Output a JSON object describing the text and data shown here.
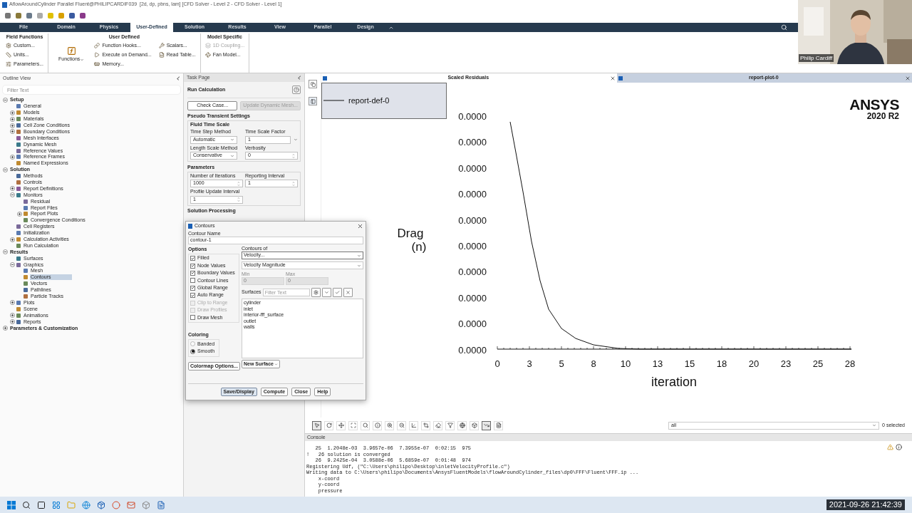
{
  "window": {
    "title": "AflowAroundCylinder Parallel Fluent@PHILIPCARDIF039  [2d, dp, pbns, lam] [CFD Solver - Level 2 - CFD Solver - Level 1]"
  },
  "ribbon": {
    "tabs": [
      {
        "label": "File",
        "selected": false
      },
      {
        "label": "Domain",
        "selected": false
      },
      {
        "label": "Physics",
        "selected": false
      },
      {
        "label": "User-Defined",
        "selected": true
      },
      {
        "label": "Solution",
        "selected": false
      },
      {
        "label": "Results",
        "selected": false
      },
      {
        "label": "View",
        "selected": false
      },
      {
        "label": "Parallel",
        "selected": false
      },
      {
        "label": "Design",
        "selected": false
      }
    ],
    "groups": [
      {
        "title": "Field Functions",
        "items": [
          {
            "kind": "small",
            "label": "Custom...",
            "disabled": false
          },
          {
            "kind": "small",
            "label": "Units...",
            "disabled": false
          },
          {
            "kind": "small",
            "label": "Parameters...",
            "disabled": false
          }
        ]
      },
      {
        "title": "User Defined",
        "items": [
          {
            "kind": "large",
            "label": "Functions",
            "disabled": false
          },
          {
            "kind": "small",
            "label": "Function Hooks...",
            "disabled": false
          },
          {
            "kind": "small",
            "label": "Execute on Demand...",
            "disabled": false
          },
          {
            "kind": "small",
            "label": "Memory...",
            "disabled": false
          },
          {
            "kind": "small",
            "label": "Scalars...",
            "disabled": false
          },
          {
            "kind": "small",
            "label": "Read Table...",
            "disabled": false
          }
        ]
      },
      {
        "title": "Model Specific",
        "items": [
          {
            "kind": "small",
            "label": "1D Coupling...",
            "disabled": true
          },
          {
            "kind": "small",
            "label": "Fan Model...",
            "disabled": false
          }
        ]
      }
    ]
  },
  "outline": {
    "title": "Outline View",
    "filter": {
      "placeholder": "Filter Text"
    },
    "tree": [
      {
        "label": "Setup",
        "expanded": true,
        "selected": false,
        "children": [
          {
            "label": "General",
            "selected": false
          },
          {
            "label": "Models",
            "expanded": false,
            "selected": false
          },
          {
            "label": "Materials",
            "expanded": false,
            "selected": false
          },
          {
            "label": "Cell Zone Conditions",
            "expanded": false,
            "selected": false
          },
          {
            "label": "Boundary Conditions",
            "expanded": false,
            "selected": false
          },
          {
            "label": "Mesh Interfaces",
            "selected": false
          },
          {
            "label": "Dynamic Mesh",
            "selected": false
          },
          {
            "label": "Reference Values",
            "selected": false
          },
          {
            "label": "Reference Frames",
            "expanded": false,
            "selected": false
          },
          {
            "label": "Named Expressions",
            "selected": false
          }
        ]
      },
      {
        "label": "Solution",
        "expanded": true,
        "selected": false,
        "children": [
          {
            "label": "Methods",
            "selected": false
          },
          {
            "label": "Controls",
            "selected": false
          },
          {
            "label": "Report Definitions",
            "expanded": false,
            "selected": false
          },
          {
            "label": "Monitors",
            "expanded": true,
            "selected": false,
            "children": [
              {
                "label": "Residual",
                "selected": false
              },
              {
                "label": "Report Files",
                "selected": false
              },
              {
                "label": "Report Plots",
                "expanded": false,
                "selected": false
              },
              {
                "label": "Convergence Conditions",
                "selected": false
              }
            ]
          },
          {
            "label": "Cell Registers",
            "selected": false
          },
          {
            "label": "Initialization",
            "selected": false
          },
          {
            "label": "Calculation Activities",
            "expanded": false,
            "selected": false
          },
          {
            "label": "Run Calculation",
            "selected": false
          }
        ]
      },
      {
        "label": "Results",
        "expanded": true,
        "selected": false,
        "children": [
          {
            "label": "Surfaces",
            "selected": false
          },
          {
            "label": "Graphics",
            "expanded": true,
            "selected": false,
            "children": [
              {
                "label": "Mesh",
                "selected": false
              },
              {
                "label": "Contours",
                "selected": true
              },
              {
                "label": "Vectors",
                "selected": false
              },
              {
                "label": "Pathlines",
                "selected": false
              },
              {
                "label": "Particle Tracks",
                "selected": false
              }
            ]
          },
          {
            "label": "Plots",
            "expanded": false,
            "selected": false
          },
          {
            "label": "Scene",
            "selected": false
          },
          {
            "label": "Animations",
            "expanded": false,
            "selected": false
          },
          {
            "label": "Reports",
            "expanded": false,
            "selected": false
          }
        ]
      },
      {
        "label": "Parameters & Customization",
        "expanded": false,
        "selected": false
      }
    ]
  },
  "task_page": {
    "title": "Task Page",
    "heading": "Run Calculation",
    "buttons": [
      {
        "label": "Check Case...",
        "disabled": false
      },
      {
        "label": "Update Dynamic Mesh...",
        "disabled": true
      }
    ],
    "section": "Pseudo Transient Settings",
    "group": "Fluid Time Scale",
    "fields": [
      {
        "label": "Time Step Method",
        "value": "Automatic",
        "kind": "dropdown"
      },
      {
        "label": "Time Scale Factor",
        "value": "1",
        "kind": "combo"
      },
      {
        "label": "Length Scale Method",
        "value": "Conservative",
        "kind": "dropdown"
      },
      {
        "label": "Verbosity",
        "value": "0",
        "kind": "spinner"
      }
    ],
    "parameters": {
      "title": "Parameters",
      "fields": [
        {
          "label": "Number of Iterations",
          "value": "1000",
          "kind": "spinner"
        },
        {
          "label": "Reporting Interval",
          "value": "1",
          "kind": "spinner"
        },
        {
          "label": "Profile Update Interval",
          "value": "1",
          "kind": "spinner"
        }
      ]
    },
    "next_section": "Solution Processing"
  },
  "contours_dialog": {
    "title": "Contours",
    "name_label": "Contour Name",
    "name_value": "contour-1",
    "options_title": "Options",
    "options": [
      {
        "label": "Filled",
        "checked": true,
        "disabled": false
      },
      {
        "label": "Node Values",
        "checked": true,
        "disabled": false
      },
      {
        "label": "Boundary Values",
        "checked": true,
        "disabled": false
      },
      {
        "label": "Contour Lines",
        "checked": false,
        "disabled": false
      },
      {
        "label": "Global Range",
        "checked": true,
        "disabled": false
      },
      {
        "label": "Auto Range",
        "checked": true,
        "disabled": false
      },
      {
        "label": "Clip to Range",
        "checked": false,
        "disabled": true
      },
      {
        "label": "Draw Profiles",
        "checked": false,
        "disabled": true
      },
      {
        "label": "Draw Mesh",
        "checked": false,
        "disabled": false
      }
    ],
    "contours_of_label": "Contours of",
    "contours_of": [
      "Velocity...",
      "Velocity Magnitude"
    ],
    "min": {
      "label": "Min",
      "value": "0",
      "disabled": true
    },
    "max": {
      "label": "Max",
      "value": "0",
      "disabled": true
    },
    "surfaces_label": "Surfaces",
    "surfaces_filter": {
      "placeholder": "Filter Text"
    },
    "surfaces": [
      {
        "label": "cylinder",
        "selected": false
      },
      {
        "label": "inlet",
        "selected": false
      },
      {
        "label": "interior-fff_surface",
        "selected": false
      },
      {
        "label": "outlet",
        "selected": false
      },
      {
        "label": "walls",
        "selected": false
      }
    ],
    "coloring_title": "Coloring",
    "coloring": [
      {
        "label": "Banded",
        "selected": false
      },
      {
        "label": "Smooth",
        "selected": true
      }
    ],
    "colormap_button": "Colormap Options...",
    "new_surface_button": "New Surface",
    "buttons": [
      "Save/Display",
      "Compute",
      "Close",
      "Help"
    ]
  },
  "graphics": {
    "tabs": [
      {
        "label": "Scaled Residuals",
        "selected": false
      },
      {
        "label": "report-plot-0",
        "selected": true
      }
    ],
    "plot": {
      "legend": "report-def-0",
      "ylabel": [
        "Drag",
        "(n)"
      ],
      "yticks": [
        "0.0000",
        "0.0000",
        "0.0000",
        "0.0000",
        "0.0000",
        "0.0000",
        "0.0000",
        "0.0000",
        "0.0000",
        "0.0000"
      ],
      "xticks": [
        "0",
        "3",
        "5",
        "8",
        "10",
        "13",
        "15",
        "18",
        "20",
        "23",
        "25",
        "28"
      ],
      "xlabel": "iteration"
    },
    "logo": {
      "name": "ANSYS",
      "version": "2020 R2"
    }
  },
  "graphics_toolbar": {
    "filter": "all",
    "selection": "0 selected"
  },
  "console": {
    "title": "Console",
    "lines": [
      "   25  1.2048e-03  3.9657e-06  7.3955e-07  0:02:15  975",
      "!   26 solution is converged",
      "   26  9.2425e-04  3.0588e-06  5.6859e-07  0:01:48  974",
      "Registering Udf, (\"C:\\Users\\philipo\\Desktop\\inletVelocityProfile.c\")",
      "Writing data to C:\\Users\\philipo\\Documents\\AnsysFluentModels\\flowAroundCylinder_files\\dp0\\FFF\\Fluent\\FFF.ip ...",
      "    x-coord",
      "    y-coord",
      "    pressure"
    ]
  },
  "webcam": {
    "name": "Philip Cardiff"
  },
  "taskbar": {
    "clock": "2021-09-26 21:42:39"
  }
}
